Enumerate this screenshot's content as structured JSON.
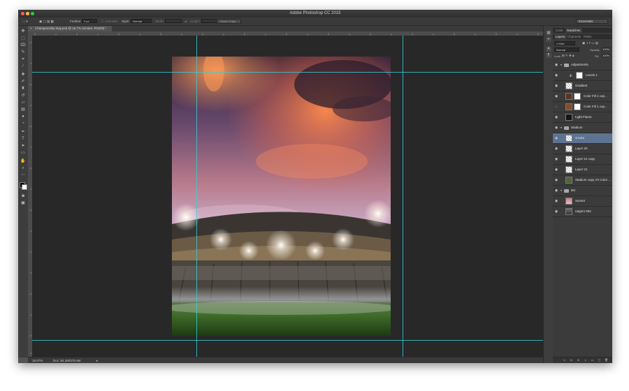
{
  "window": {
    "title": "Adobe Photoshop CC 2015"
  },
  "options": {
    "feather_label": "Feather:",
    "feather_value": "0 px",
    "antialias_label": "Anti-alias",
    "style_label": "Style:",
    "style_value": "Normal",
    "width_label": "Width:",
    "height_label": "Height:",
    "refine_edge": "Refine Edge..."
  },
  "workspace": "Essentials",
  "document": {
    "tab_title": "Championship Day.psd @ 16.7% (smoke, RGB/8) *"
  },
  "status": {
    "zoom": "16.67%",
    "doc_size": "Doc: 84.2M/379.4M"
  },
  "panels": {
    "top_tabs": [
      "Color",
      "Swatches"
    ],
    "layer_tabs": [
      "Layers",
      "Channels",
      "Paths"
    ],
    "kind_label": "Kind",
    "blend_mode": "Normal",
    "opacity_label": "Opacity:",
    "opacity_value": "100%",
    "lock_label": "Lock:",
    "fill_label": "Fill:",
    "fill_value": "100%"
  },
  "layers": [
    {
      "name": "Adjustments",
      "type": "group"
    },
    {
      "name": "Levels 1",
      "type": "adjustment"
    },
    {
      "name": "Gradient",
      "type": "layer"
    },
    {
      "name": "Color Fill 1 cop...",
      "type": "fill"
    },
    {
      "name": "Color Fill 1 cop...",
      "type": "fill"
    },
    {
      "name": "Light Flares",
      "type": "layer"
    },
    {
      "name": "Stadium",
      "type": "group"
    },
    {
      "name": "smoke",
      "type": "layer",
      "selected": true
    },
    {
      "name": "Layer 20",
      "type": "layer"
    },
    {
      "name": "Layer 21 copy",
      "type": "layer"
    },
    {
      "name": "Layer 21",
      "type": "layer"
    },
    {
      "name": "Stadium copy 2's Color ...",
      "type": "layer"
    },
    {
      "name": "BG",
      "type": "group"
    },
    {
      "name": "Sunset",
      "type": "layer"
    },
    {
      "name": "rutgers 004",
      "type": "layer"
    }
  ],
  "colors": {
    "guide": "#2fd2d8",
    "selection": "#5d7391",
    "ui_dark": "#282828"
  }
}
